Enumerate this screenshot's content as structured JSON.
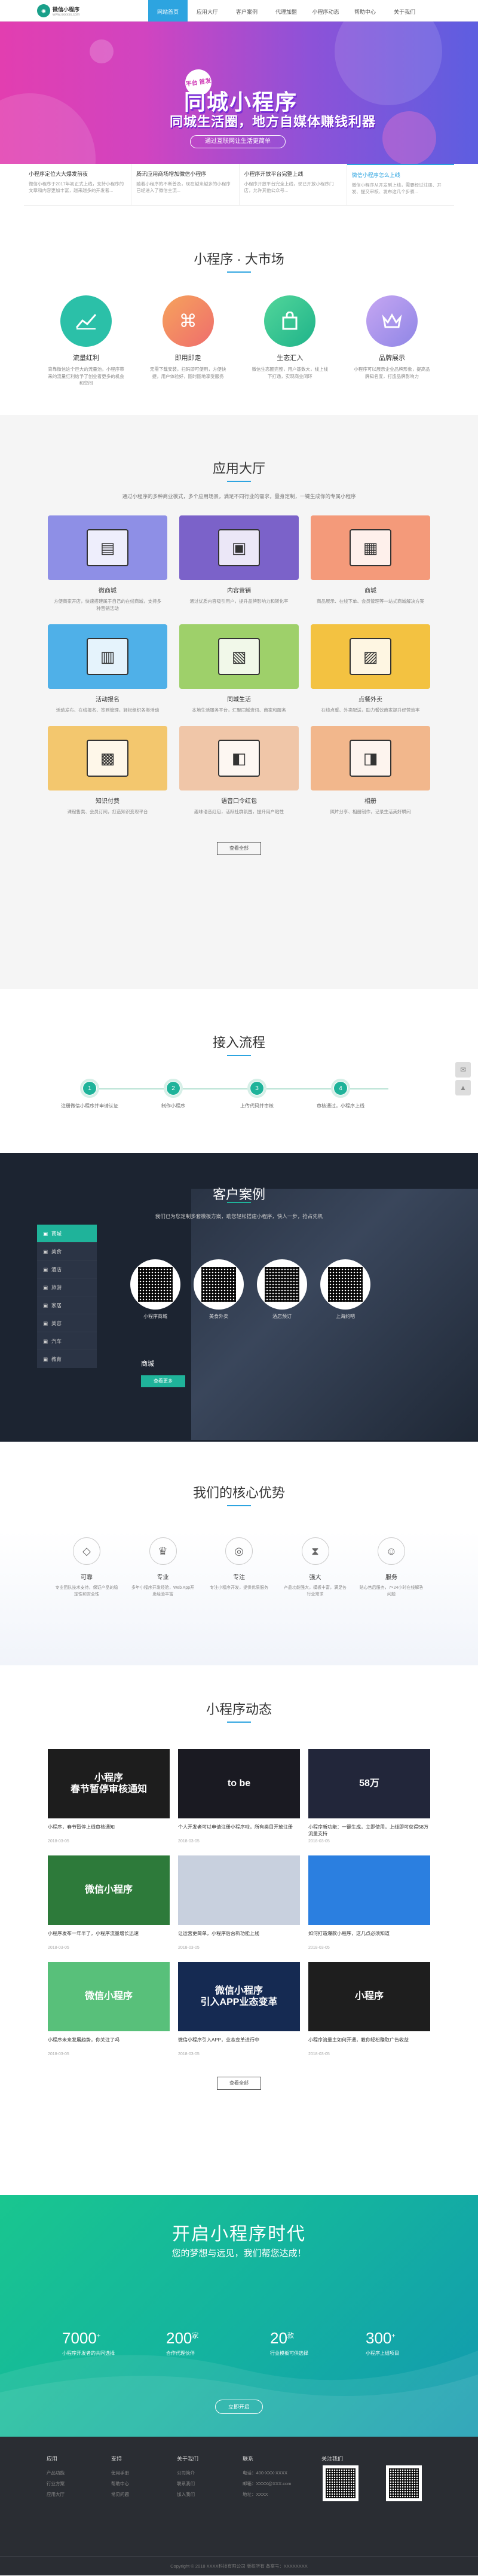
{
  "header": {
    "logo_text": "微信小程序",
    "logo_sub": "www.xxxxxx.com",
    "nav": [
      "网站首页",
      "应用大厅",
      "客户案例",
      "代理加盟",
      "小程序动态",
      "帮助中心",
      "关于我们"
    ]
  },
  "banner": {
    "badge": "平台 首发",
    "title": "同城小程序",
    "subtitle": "同城生活圈，地方自媒体赚钱利器",
    "button": "通过互联网让生活更简单"
  },
  "news_strip": [
    {
      "title": "小程序定位大大爆发前夜",
      "desc": "微信小程序于2017年初正式上线，支持小程序的文章和内容更加丰富，越来越多的开发者..."
    },
    {
      "title": "腾讯应用商场增加微信小程序",
      "desc": "随着小程序的不断普及，现在越来越多的小程序已经进入了微信主流..."
    },
    {
      "title": "小程序开放平台完整上线",
      "desc": "小程序开放平台完全上线，现已开放小程序门店，允许其他公众号..."
    },
    {
      "title": "微信小程序怎么上线",
      "desc": "微信小程序从开发到上线，需要经过注册、开发、提交审核、发布这几个步骤..."
    }
  ],
  "market": {
    "title": "小程序 · 大市场",
    "items": [
      {
        "title": "流量红利",
        "desc": "背靠微信这个巨大的流量池，小程序带来的流量红利给予了创业者更多的机会和空间",
        "icon": "chart-icon",
        "color": "#2bc0a8"
      },
      {
        "title": "即用即走",
        "desc": "无需下载安装，扫码即可使用，方便快捷，用户体验好，随时随地享受服务",
        "icon": "command-icon",
        "color": "#f2845f"
      },
      {
        "title": "生态汇入",
        "desc": "微信生态圈完整，用户基数大，线上线下打通，实现商业闭环",
        "icon": "bag-icon",
        "color": "#2ec27e"
      },
      {
        "title": "品牌展示",
        "desc": "小程序可以展示企业品牌形象，提高品牌知名度，打造品牌影响力",
        "icon": "crown-icon",
        "color": "#a98ee8"
      }
    ]
  },
  "apps": {
    "title": "应用大厅",
    "intro": "通过小程序的多种商业模式，多个应用场景，满足不同行业的需求，量身定制，一键生成你的专属小程序",
    "items": [
      {
        "title": "微商城",
        "desc": "方便商家开店，快速搭建属于自己的在线商城，支持多种营销活动",
        "color": "#8e8fe6",
        "icon": "▤"
      },
      {
        "title": "内容营销",
        "desc": "通过优质内容吸引用户，提升品牌影响力和转化率",
        "color": "#7b62c9",
        "icon": "▣"
      },
      {
        "title": "商城",
        "desc": "商品展示、在线下单、会员管理等一站式商城解决方案",
        "color": "#f49a7a",
        "icon": "▦"
      },
      {
        "title": "活动报名",
        "desc": "活动发布、在线报名、签到管理，轻松组织各类活动",
        "color": "#4fb0e8",
        "icon": "▥"
      },
      {
        "title": "同城生活",
        "desc": "本地生活服务平台，汇聚同城资讯、商家和服务",
        "color": "#9ed06a",
        "icon": "▧"
      },
      {
        "title": "点餐外卖",
        "desc": "在线点餐、外卖配送，助力餐饮商家提升经营效率",
        "color": "#f3c241",
        "icon": "▨"
      },
      {
        "title": "知识付费",
        "desc": "课程售卖、会员订阅，打造知识变现平台",
        "color": "#f3c76e",
        "icon": "▩"
      },
      {
        "title": "语音口令红包",
        "desc": "趣味语音红包，活跃社群氛围，提升用户粘性",
        "color": "#f0c6a8",
        "icon": "◧"
      },
      {
        "title": "相册",
        "desc": "照片分享、相册制作，记录生活美好瞬间",
        "color": "#f2b78c",
        "icon": "◨"
      }
    ],
    "more": "查看全部"
  },
  "flow": {
    "title": "接入流程",
    "steps": [
      {
        "n": "1",
        "label": "注册微信小程序并申请认证"
      },
      {
        "n": "2",
        "label": "制作小程序"
      },
      {
        "n": "3",
        "label": "上传代码并审核"
      },
      {
        "n": "4",
        "label": "审核通过，小程序上线"
      }
    ]
  },
  "cases": {
    "title": "客户案例",
    "intro": "我们已为您定制多套模板方案，助您轻松搭建小程序，快人一步，抢占先机",
    "categories": [
      "商城",
      "美食",
      "酒店",
      "旅游",
      "家居",
      "美容",
      "汽车",
      "教育"
    ],
    "qrs": [
      "小程序商城",
      "美食外卖",
      "酒店预订",
      "上海约吧"
    ],
    "current": "商城",
    "more": "查看更多"
  },
  "advantages": {
    "title": "我们的核心优势",
    "items": [
      {
        "title": "可靠",
        "desc": "专业团队技术支持，保证产品的稳定性和安全性"
      },
      {
        "title": "专业",
        "desc": "多年小程序开发经验，Web App开发经验丰富"
      },
      {
        "title": "专注",
        "desc": "专注小程序开发，提供优质服务"
      },
      {
        "title": "强大",
        "desc": "产品功能强大，模板丰富，满足各行业需求"
      },
      {
        "title": "服务",
        "desc": "贴心售后服务，7×24小时在线解答问题"
      }
    ]
  },
  "dynamic": {
    "title": "小程序动态",
    "items": [
      {
        "title": "小程序，春节暂停上线审核通知",
        "date": "2018-03-05",
        "img": "小程序\n春节暂停审核通知",
        "bg": "#1d1d1d"
      },
      {
        "title": "个人开发者可以申请注册小程序啦，所有类目开放注册",
        "date": "2018-03-05",
        "img": "to be",
        "bg": "#1a1a22"
      },
      {
        "title": "小程序新功能：一键生成，立即使用，上线即可获得58万流量支持",
        "date": "2018-03-05",
        "img": "58万",
        "bg": "#22263a"
      },
      {
        "title": "小程序发布一年半了，小程序流量增长迅速",
        "date": "2018-03-05",
        "img": "微信小程序",
        "bg": "#2d7a3a"
      },
      {
        "title": "让运营更简单，小程序后台新功能上线",
        "date": "2018-03-05",
        "img": "",
        "bg": "#c8d0de"
      },
      {
        "title": "如何打造爆款小程序，这几点必须知道",
        "date": "2018-03-05",
        "img": "",
        "bg": "#2b7fe0"
      },
      {
        "title": "小程序未来发展趋势，你关注了吗",
        "date": "2018-03-05",
        "img": "微信小程序",
        "bg": "#58c07a"
      },
      {
        "title": "微信小程序引入APP，业态变革进行中",
        "date": "2018-03-05",
        "img": "微信小程序\n引入APP业态变革",
        "bg": "#152a52"
      },
      {
        "title": "小程序流量主如何开通，教你轻松赚取广告收益",
        "date": "2018-03-05",
        "img": "小程序",
        "bg": "#1e1e1e"
      }
    ],
    "more": "查看全部"
  },
  "era": {
    "title": "开启小程序时代",
    "subtitle": "您的梦想与远见，我们帮您达成！",
    "stats": [
      {
        "n": "7000",
        "unit": "+",
        "label": "小程序开发者的共同选择"
      },
      {
        "n": "200",
        "unit": "家",
        "label": "合作代理伙伴"
      },
      {
        "n": "20",
        "unit": "款",
        "label": "行业模板可供选择"
      },
      {
        "n": "300",
        "unit": "+",
        "label": "小程序上线项目"
      }
    ],
    "button": "立即开启"
  },
  "footer": {
    "cols": [
      {
        "h": "应用",
        "links": [
          "产品功能",
          "行业方案",
          "应用大厅"
        ]
      },
      {
        "h": "支持",
        "links": [
          "使用手册",
          "帮助中心",
          "常见问题"
        ]
      },
      {
        "h": "关于我们",
        "links": [
          "公司简介",
          "联系我们",
          "加入我们"
        ]
      },
      {
        "h": "联系",
        "links": [
          "电话：400-XXX-XXXX",
          "邮箱：XXXX@XXX.com",
          "地址：XXXX"
        ]
      }
    ],
    "qr_label": "关注我们",
    "copyright": "Copyright © 2018 XXXX科技有限公司 版权所有 备案号：XXXXXXXX"
  }
}
